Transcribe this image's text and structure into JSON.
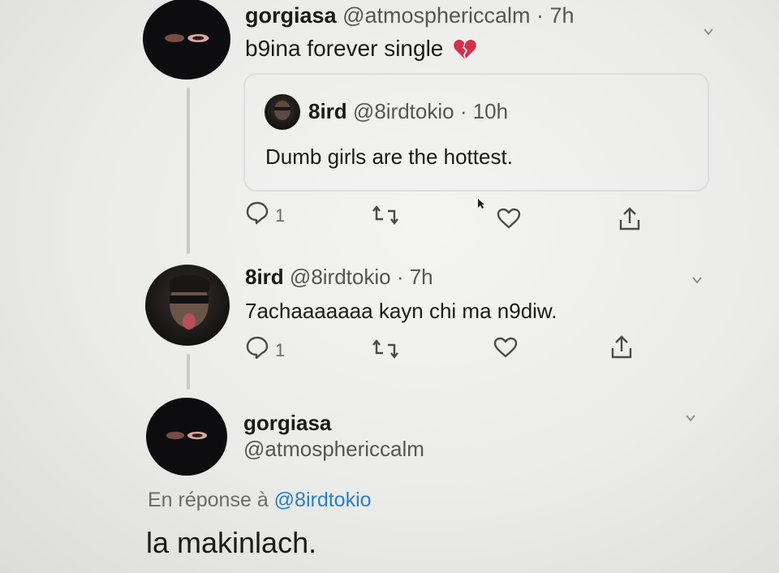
{
  "tweet1": {
    "username": "gorgiasa",
    "handle_time": "@atmosphericcalm · 7h",
    "text": "b9ina forever single",
    "emoji": "💔",
    "quote": {
      "username": "8ird",
      "handle_time": "@8irdtokio · 10h",
      "text": "Dumb girls are the hottest."
    },
    "reply_count": "1"
  },
  "tweet2": {
    "username": "8ird",
    "handle_time": "@8irdtokio · 7h",
    "text": "7achaaaaaaa kayn chi ma n9diw.",
    "reply_count": "1"
  },
  "tweet3": {
    "username": "gorgiasa",
    "handle": "@atmosphericcalm",
    "reply_prefix": "En réponse à",
    "reply_to": "@8irdtokio",
    "text": "la makinlach."
  },
  "icons": [
    "chevron-down-icon",
    "reply-icon",
    "retweet-icon",
    "like-icon",
    "share-icon",
    "broken-heart-icon"
  ],
  "colors": {
    "link": "#2b7fc2",
    "text": "#1a1a1a",
    "muted": "#6b6b6b",
    "border": "#d9dde0"
  }
}
